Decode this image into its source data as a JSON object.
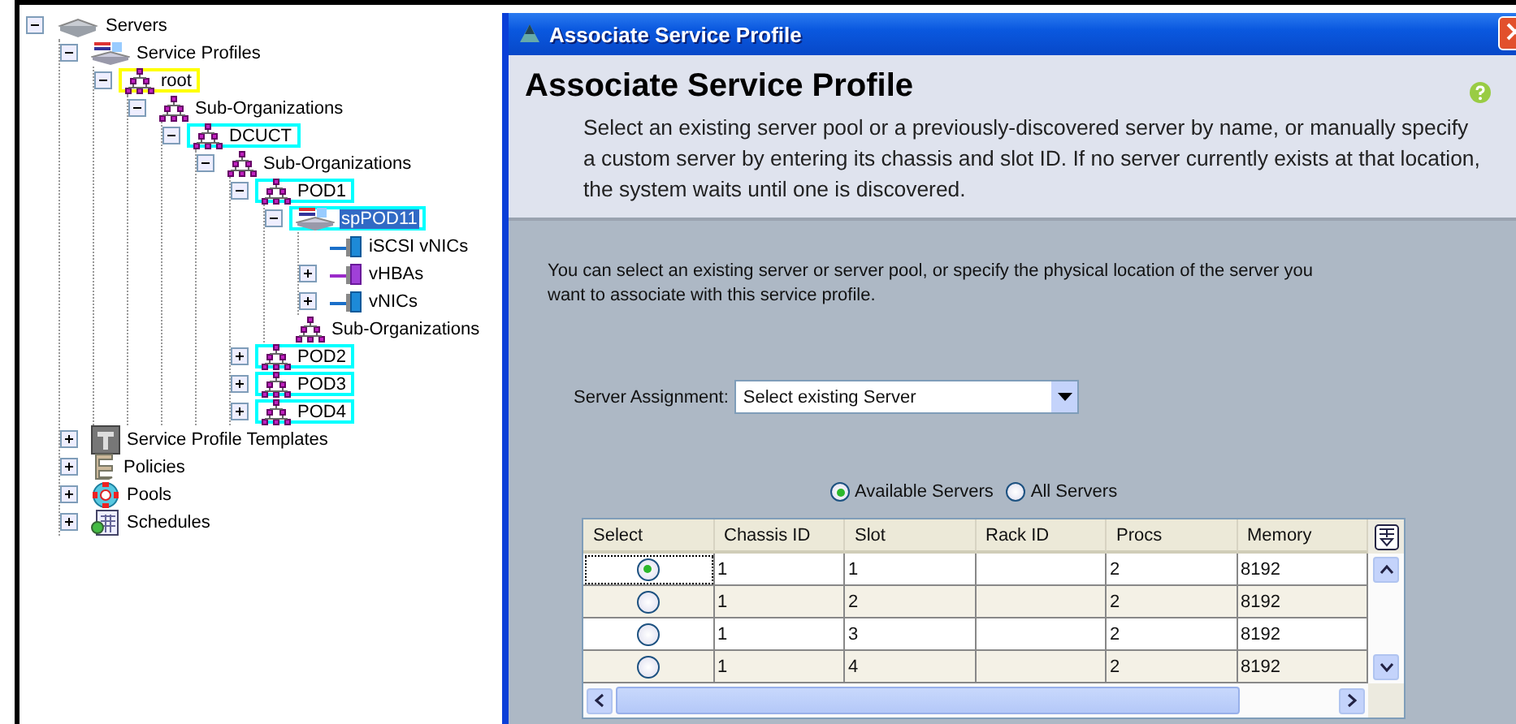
{
  "tree": [
    {
      "label": "Servers",
      "kind": "server",
      "expanded": true,
      "selected": false,
      "children": [
        {
          "label": "Service Profiles",
          "kind": "profiles",
          "expanded": true,
          "selected": false,
          "children": [
            {
              "label": "root",
              "kind": "org",
              "expanded": true,
              "selected": false,
              "color": "#ffff00",
              "children": [
                {
                  "label": "Sub-Organizations",
                  "kind": "org",
                  "expanded": true,
                  "selected": false,
                  "children": [
                    {
                      "label": "DCUCT",
                      "kind": "org",
                      "expanded": true,
                      "selected": false,
                      "color": "#00ffff",
                      "children": [
                        {
                          "label": "Sub-Organizations",
                          "kind": "org",
                          "expanded": true,
                          "selected": false,
                          "children": [
                            {
                              "label": "POD1",
                              "kind": "org",
                              "expanded": true,
                              "selected": false,
                              "color": "#00ffff",
                              "children": [
                                {
                                  "label": "spPOD11",
                                  "kind": "profiles",
                                  "expanded": true,
                                  "selected": true,
                                  "color": "#00ffff",
                                  "children": [
                                    {
                                      "label": "iSCSI vNICs",
                                      "kind": "vnic",
                                      "selected": false
                                    },
                                    {
                                      "label": "vHBAs",
                                      "kind": "vhba",
                                      "expanded": false,
                                      "selected": false
                                    },
                                    {
                                      "label": "vNICs",
                                      "kind": "vnic",
                                      "expanded": false,
                                      "selected": false
                                    }
                                  ]
                                },
                                {
                                  "label": "Sub-Organizations",
                                  "kind": "org",
                                  "selected": false
                                }
                              ]
                            },
                            {
                              "label": "POD2",
                              "kind": "org",
                              "expanded": false,
                              "selected": false,
                              "color": "#00ffff"
                            },
                            {
                              "label": "POD3",
                              "kind": "org",
                              "expanded": false,
                              "selected": false,
                              "color": "#00ffff"
                            },
                            {
                              "label": "POD4",
                              "kind": "org",
                              "expanded": false,
                              "selected": false,
                              "color": "#00ffff"
                            }
                          ]
                        }
                      ]
                    }
                  ]
                }
              ]
            }
          ]
        },
        {
          "label": "Service Profile Templates",
          "kind": "template",
          "expanded": false,
          "selected": false
        },
        {
          "label": "Policies",
          "kind": "policies",
          "expanded": false,
          "selected": false
        },
        {
          "label": "Pools",
          "kind": "pools",
          "expanded": false,
          "selected": false
        },
        {
          "label": "Schedules",
          "kind": "schedules",
          "expanded": false,
          "selected": false
        }
      ]
    }
  ],
  "dialog": {
    "title": "Associate Service Profile",
    "heading": "Associate Service Profile",
    "description": "Select an existing server pool or a previously-discovered server by name, or manually specify a custom server by entering its chassis and slot ID. If no server currently exists at that location, the system waits until one is discovered.",
    "intro": "You can select an existing server or server pool, or specify the physical location of the server you want to associate with this service profile.",
    "assignment": {
      "label": "Server Assignment:",
      "value": "Select existing Server"
    },
    "filters": [
      {
        "label": "Available Servers",
        "selected": true
      },
      {
        "label": "All Servers",
        "selected": false
      }
    ],
    "table": {
      "columns": [
        "Select",
        "Chassis ID",
        "Slot",
        "Rack ID",
        "Procs",
        "Memory"
      ],
      "rows": [
        {
          "selected": true,
          "cells": [
            "1",
            "1",
            "",
            "2",
            "8192"
          ]
        },
        {
          "selected": false,
          "cells": [
            "1",
            "2",
            "",
            "2",
            "8192"
          ]
        },
        {
          "selected": false,
          "cells": [
            "1",
            "3",
            "",
            "2",
            "8192"
          ]
        },
        {
          "selected": false,
          "cells": [
            "1",
            "4",
            "",
            "2",
            "8192"
          ]
        }
      ]
    }
  }
}
